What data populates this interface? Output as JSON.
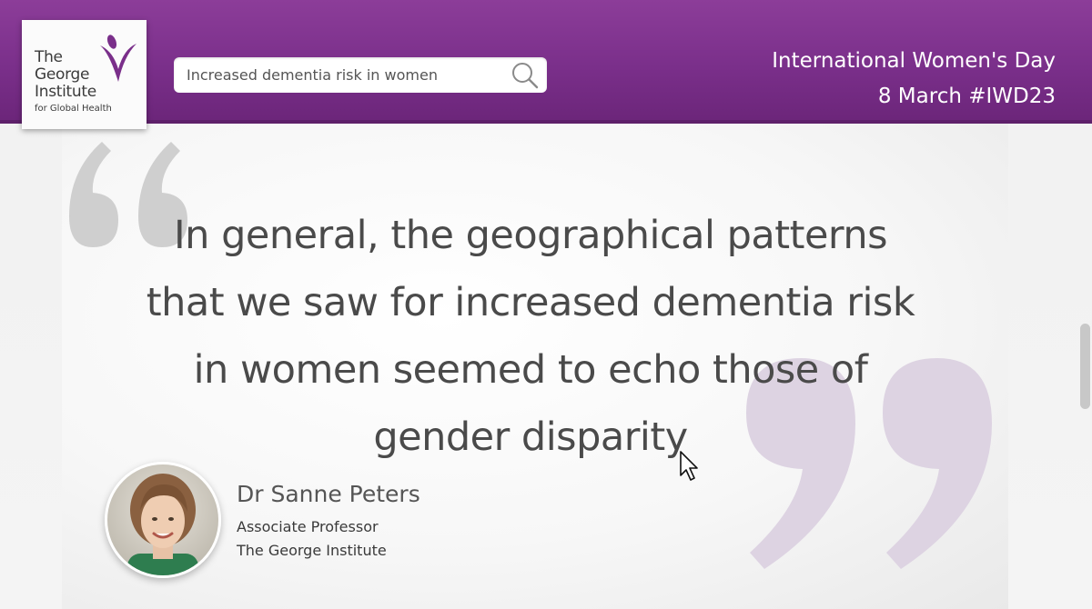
{
  "logo": {
    "line1": "The",
    "line2": "George",
    "line3": "Institute",
    "line4": "for Global Health"
  },
  "search": {
    "value": "Increased dementia risk in women",
    "icon": "search-icon"
  },
  "event": {
    "line1": "International Women's Day",
    "line2": "8 March  #IWD23"
  },
  "quote": {
    "lines": [
      "In general, the geographical patterns",
      "that we saw for increased dementia risk",
      "in women seemed to echo those of",
      "gender disparity"
    ]
  },
  "speaker": {
    "name": "Dr Sanne Peters",
    "role": "Associate Professor",
    "org": "The George Institute"
  },
  "colors": {
    "brand": "#7a2f8a",
    "quote_mark_open": "#cfcfcf",
    "quote_mark_close": "#ddd3e2",
    "text": "#4a4a4a"
  }
}
